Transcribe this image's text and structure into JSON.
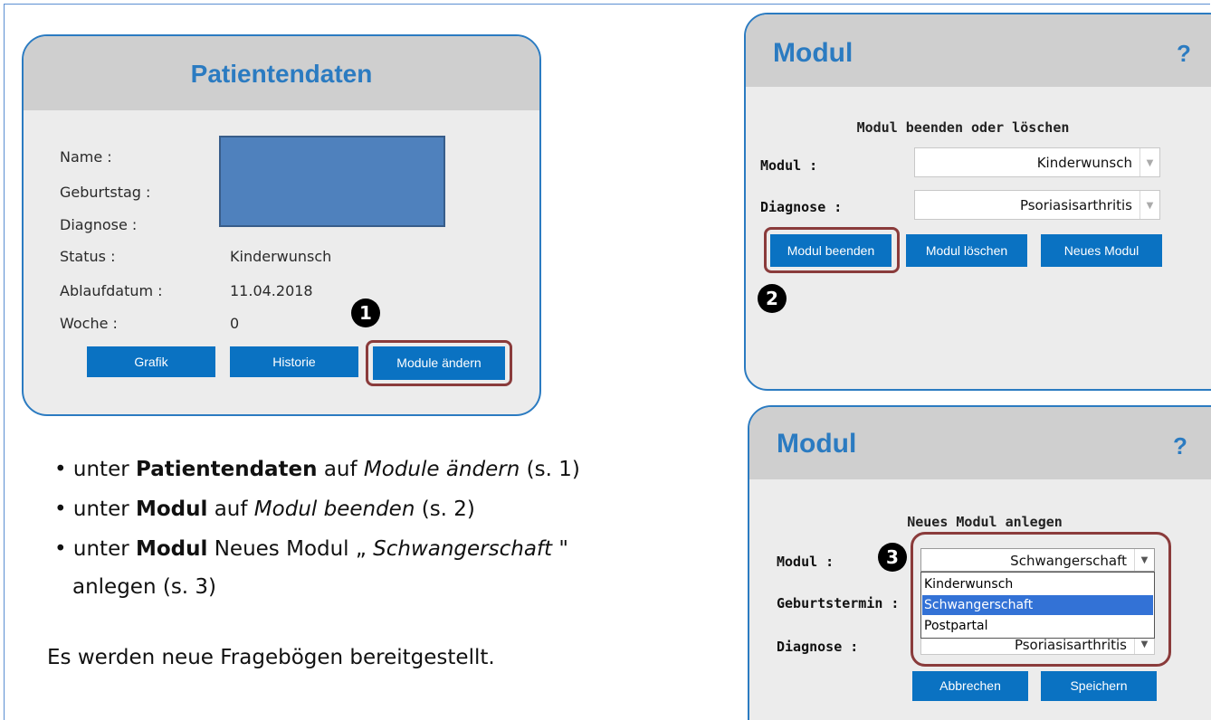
{
  "patientendaten": {
    "title": "Patientendaten",
    "labels": [
      "Name :",
      "Geburtstag :",
      "Diagnose :",
      "Status :",
      "Ablaufdatum :",
      "Woche :"
    ],
    "status": "Kinderwunsch",
    "ablaufdatum": "11.04.2018",
    "woche": "0",
    "buttons": {
      "grafik": "Grafik",
      "historie": "Historie",
      "module_aendern": "Module ändern"
    },
    "marker": "1"
  },
  "modul_end": {
    "title": "Modul",
    "help": "?",
    "subtitle": "Modul beenden oder löschen",
    "modul_label": "Modul :",
    "modul_value": "Kinderwunsch",
    "diagnose_label": "Diagnose :",
    "diagnose_value": "Psoriasisarthritis",
    "buttons": {
      "beenden": "Modul beenden",
      "loeschen": "Modul löschen",
      "neues": "Neues Modul"
    },
    "marker": "2"
  },
  "modul_new": {
    "title": "Modul",
    "help": "?",
    "subtitle": "Neues Modul anlegen",
    "modul_label": "Modul :",
    "modul_value": "Schwangerschaft",
    "geburtstermin_label": "Geburtstermin :",
    "diagnose_label": "Diagnose :",
    "diagnose_value": "Psoriasisarthritis",
    "options": [
      "Kinderwunsch",
      "Schwangerschaft",
      "Postpartal"
    ],
    "selected_option": "Schwangerschaft",
    "buttons": {
      "abbrechen": "Abbrechen",
      "speichern": "Speichern"
    },
    "marker": "3"
  },
  "instructions": {
    "b1": {
      "pre": "unter ",
      "bold": "Patientendaten",
      "mid": " auf ",
      "italic": "Module ändern",
      "post": "  (s. 1)"
    },
    "b2": {
      "pre": "unter ",
      "bold": "Modul",
      "mid": " auf ",
      "italic": "Modul beenden",
      "post": "  (s. 2)"
    },
    "b3": {
      "pre": "unter ",
      "bold": "Modul",
      "mid": " Neues Modul „ ",
      "italic": "Schwangerschaft",
      "post": " \""
    },
    "b3_line2": "anlegen (s. 3)",
    "footer": "Es werden neue Fragebögen bereitgestellt."
  },
  "colors": {
    "accent": "#2b7bc1",
    "button": "#0a72c2",
    "highlight": "#8a3b3b",
    "redaction": "#4f81bd"
  }
}
